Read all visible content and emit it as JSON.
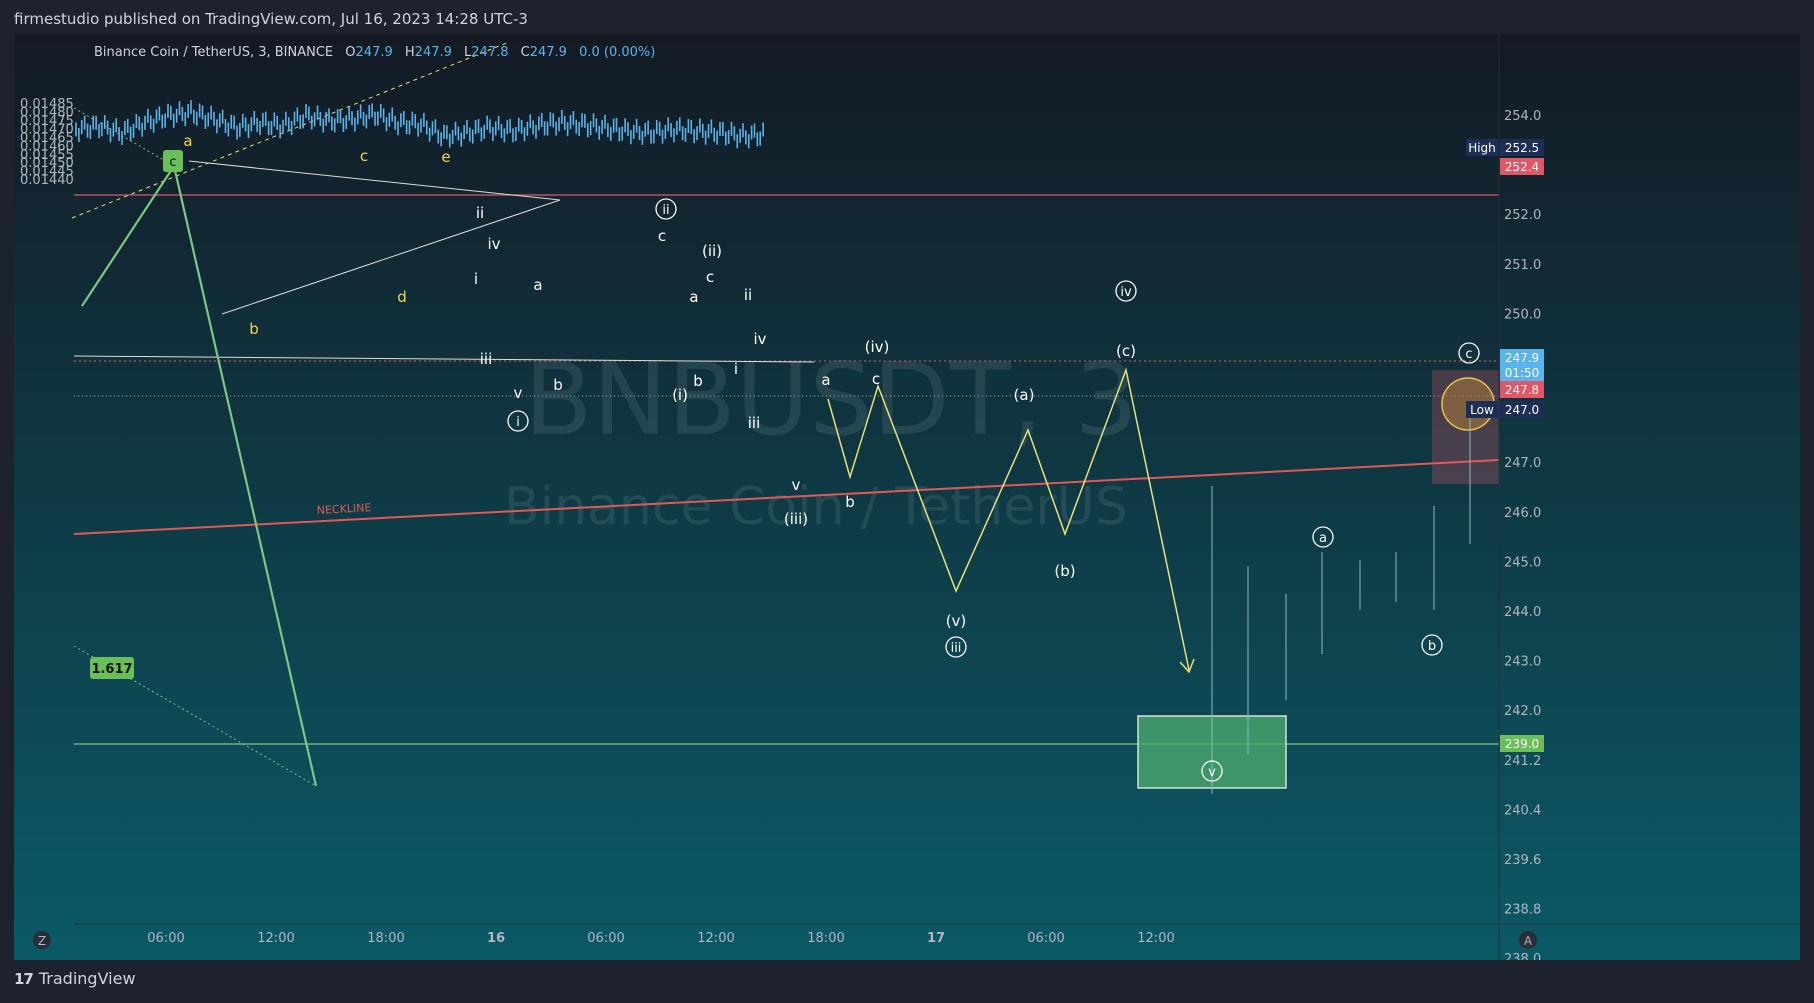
{
  "header": {
    "published": "firmestudio published on TradingView.com, Jul 16, 2023 14:28 UTC-3"
  },
  "legend": {
    "symbol": "Binance Coin / TetherUS, 3, BINANCE",
    "o_label": "O",
    "o": "247.9",
    "h_label": "H",
    "h": "247.9",
    "l_label": "L",
    "l": "247.8",
    "c_label": "C",
    "c": "247.9",
    "change": "0.0 (0.00%)"
  },
  "watermark": {
    "line1": "BNBUSDT, 3",
    "line2": "Binance Coin / TetherUS"
  },
  "footer": {
    "brand": "TradingView",
    "left_btn": "Z",
    "right_btn": "A"
  },
  "colors": {
    "background_top": "#131a24",
    "background_bottom": "#0a5a66",
    "candle": "#5ab4ea",
    "neckline": "#e05858",
    "projection": "#e8e07a",
    "green_line": "#7dc785",
    "target_box": "#4caf6e",
    "yellow_label": "#f5d547"
  },
  "chart_data": {
    "type": "line",
    "title": "BNBUSDT, 3",
    "left_axis": {
      "ticks": [
        "0.01485",
        "0.01480",
        "0.01475",
        "0.01470",
        "0.01465",
        "0.01460",
        "0.01455",
        "0.01450",
        "0.01445",
        "0.01440"
      ]
    },
    "right_axis": {
      "ticks": [
        "254.0",
        "253.0",
        "252.0",
        "251.0",
        "250.0",
        "249.0",
        "248.0",
        "247.0",
        "246.0",
        "245.0",
        "244.0",
        "243.0",
        "242.0",
        "241.2",
        "240.4",
        "239.6",
        "238.8",
        "238.0"
      ],
      "tags": [
        {
          "label": "High",
          "value": "252.5",
          "color": "#1d2f57"
        },
        {
          "label": "",
          "value": "252.4",
          "color": "#e05868"
        },
        {
          "label": "",
          "value": "247.9",
          "sub": "01:50",
          "color": "#5ab4ea"
        },
        {
          "label": "",
          "value": "247.8",
          "color": "#e05868"
        },
        {
          "label": "Low",
          "value": "247.0",
          "color": "#1d2f57"
        },
        {
          "label": "",
          "value": "239.0",
          "color": "#6bbf59"
        }
      ]
    },
    "x_ticks": [
      "06:00",
      "12:00",
      "18:00",
      "16",
      "06:00",
      "12:00",
      "18:00",
      "17",
      "06:00",
      "12:00"
    ],
    "series": [
      {
        "values": [
          0.0147,
          0.01472,
          0.01468,
          0.01474,
          0.01478,
          0.0148,
          0.01476,
          0.01471,
          0.01474,
          0.01472,
          0.01478,
          0.01475,
          0.01476,
          0.01479,
          0.01474,
          0.01473,
          0.01466,
          0.01468,
          0.01471,
          0.01469,
          0.01472,
          0.01474,
          0.01473,
          0.01471,
          0.01469,
          0.01468,
          0.0147,
          0.01469,
          0.01468,
          0.01466,
          0.01467
        ]
      }
    ],
    "projection_path": [
      0.01466,
      0.01459,
      0.01464,
      0.01452,
      0.01461,
      0.01455,
      0.01465,
      0.01446
    ],
    "annotations": {
      "neckline": "NECKLINE",
      "fib": "1.617",
      "wave_labels_yellow": [
        "a",
        "c",
        "e",
        "b",
        "d"
      ],
      "wave_labels_white": [
        "ii",
        "iv",
        "i",
        "iii",
        "v",
        "a",
        "b",
        "c",
        "a",
        "b",
        "(i)",
        "(ii)",
        "c",
        "ii",
        "iv",
        "i",
        "iii",
        "v",
        "(iii)",
        "a",
        "b",
        "c",
        "(iv)",
        "(a)",
        "(b)",
        "(c)"
      ],
      "wave_labels_circled": [
        "c",
        "ii",
        "i",
        "iv",
        "iii",
        "a",
        "b",
        "c",
        "v"
      ],
      "wave_labels_paren": [
        "(v)"
      ]
    }
  }
}
